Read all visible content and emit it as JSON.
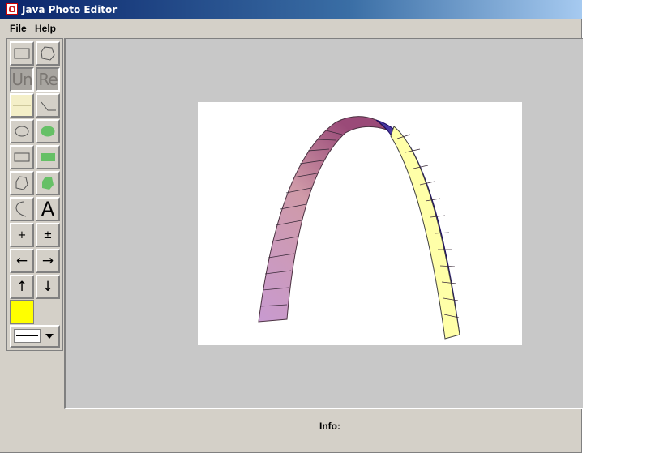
{
  "window": {
    "title": "Java Photo Editor"
  },
  "menu": {
    "items": [
      "File",
      "Help"
    ]
  },
  "tools": {
    "undo_label": "Un",
    "redo_label": "Re",
    "text_tool_label": "A",
    "zoom_in_label": "+",
    "zoom_out_label": "±",
    "move_left_label": "←",
    "move_right_label": "→",
    "move_up_label": "↑",
    "move_down_label": "↓",
    "current_color": "#ffff00",
    "stroke_style": "solid-line"
  },
  "canvas": {
    "background": "#c8c8c8",
    "image_background": "#ffffff",
    "image_colors": {
      "left_leg": "#c89ad0",
      "arch_top": "#7a3a6a",
      "right_inner": "#2a10a0",
      "right_outer": "#ffffa8"
    }
  },
  "status": {
    "info_label": "Info:",
    "info_value": ""
  }
}
